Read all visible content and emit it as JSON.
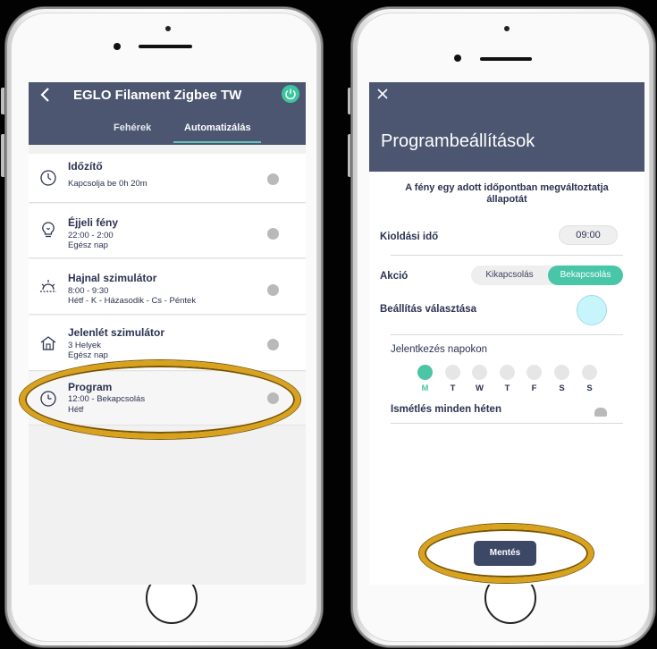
{
  "left_screen": {
    "title": "EGLO Filament Zigbee TW",
    "tabs": [
      "Fehérek",
      "Automatizálás"
    ],
    "items": [
      {
        "title": "Időzítő",
        "lines": [
          "Kapcsolja be 0h 20m"
        ],
        "icon": "timer-icon"
      },
      {
        "title": "Éjjeli fény",
        "lines": [
          "22:00 - 2:00",
          "Egész nap"
        ],
        "icon": "night-light-icon"
      },
      {
        "title": "Hajnal szimulátor",
        "lines": [
          "8:00 - 9:30",
          "Hétf - K - Házasodik - Cs - Péntek"
        ],
        "icon": "sunrise-icon"
      },
      {
        "title": "Jelenlét szimulátor",
        "lines": [
          "3 Helyek",
          "Egész nap"
        ],
        "icon": "house-icon"
      },
      {
        "title": "Program",
        "lines": [
          "12:00 - Bekapcsolás",
          "Hétf"
        ],
        "icon": "clock-icon"
      }
    ]
  },
  "right_screen": {
    "title": "Programbeállítások",
    "description": "A fény egy adott időpontban megváltoztatja állapotát",
    "trigger_label": "Kioldási idő",
    "trigger_value": "09:00",
    "action_label": "Akció",
    "action_off": "Kikapcsolás",
    "action_on": "Bekapcsolás",
    "setting_label": "Beállítás választása",
    "days_label": "Jelentkezés napokon",
    "days": [
      "M",
      "T",
      "W",
      "T",
      "F",
      "S",
      "S"
    ],
    "selected_day_index": 0,
    "repeat_label": "Ismétlés minden héten",
    "save_label": "Mentés"
  },
  "colors": {
    "header": "#4c5670",
    "accent": "#48c6a7",
    "highlight_ring": "#d8a21e",
    "selected_color": "#c8f4fb"
  }
}
